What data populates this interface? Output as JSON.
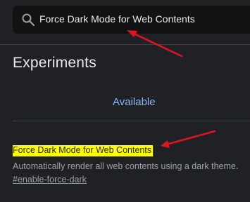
{
  "search": {
    "value": "Force Dark Mode for Web Contents",
    "icon": "search-icon"
  },
  "page": {
    "title": "Experiments"
  },
  "tabs": [
    {
      "label": "Available",
      "selected": true
    }
  ],
  "experiment": {
    "name": "Force Dark Mode for Web Contents",
    "description": "Automatically render all web contents using a dark theme.",
    "link": "#enable-force-dark",
    "highlight_color": "#ffff00"
  },
  "annotations": {
    "arrow_color": "#e0141e"
  }
}
